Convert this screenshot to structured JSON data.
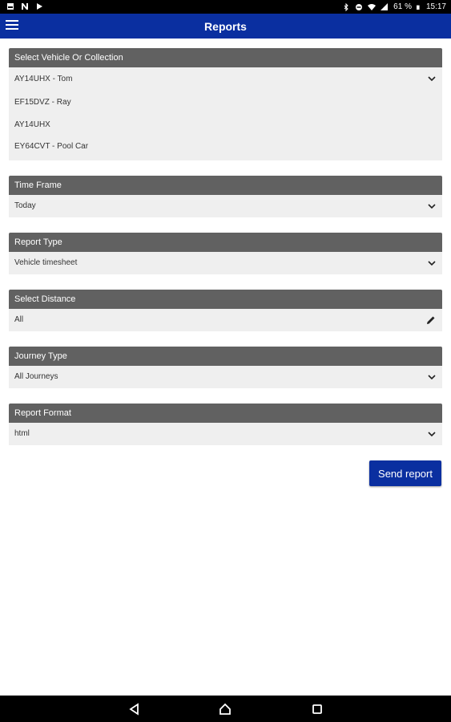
{
  "status_bar": {
    "battery": "61 %",
    "time": "15:17",
    "left_icons": [
      "gallery-icon",
      "notification-n-icon",
      "play-store-icon"
    ],
    "right_icons": [
      "bluetooth-icon",
      "do-not-disturb-icon",
      "wifi-icon",
      "signal-icon",
      "battery-icon"
    ]
  },
  "app_bar": {
    "title": "Reports",
    "menu_icon": "hamburger-menu-icon"
  },
  "sections": {
    "vehicle": {
      "header": "Select Vehicle Or Collection",
      "options": [
        "AY14UHX - Tom",
        "EF15DVZ - Ray",
        "AY14UHX",
        "EY64CVT - Pool Car"
      ]
    },
    "time_frame": {
      "header": "Time Frame",
      "value": "Today"
    },
    "report_type": {
      "header": "Report Type",
      "value": "Vehicle timesheet"
    },
    "distance": {
      "header": "Select Distance",
      "value": "All"
    },
    "journey_type": {
      "header": "Journey Type",
      "value": "All Journeys"
    },
    "report_format": {
      "header": "Report Format",
      "value": "html"
    }
  },
  "send_button": {
    "label": "Send report"
  },
  "colors": {
    "primary": "#0a2fa0",
    "header_bg": "#616161",
    "body_bg": "#efefef"
  },
  "nav_bar": {
    "icons": [
      "back-icon",
      "home-icon",
      "recents-icon"
    ]
  }
}
